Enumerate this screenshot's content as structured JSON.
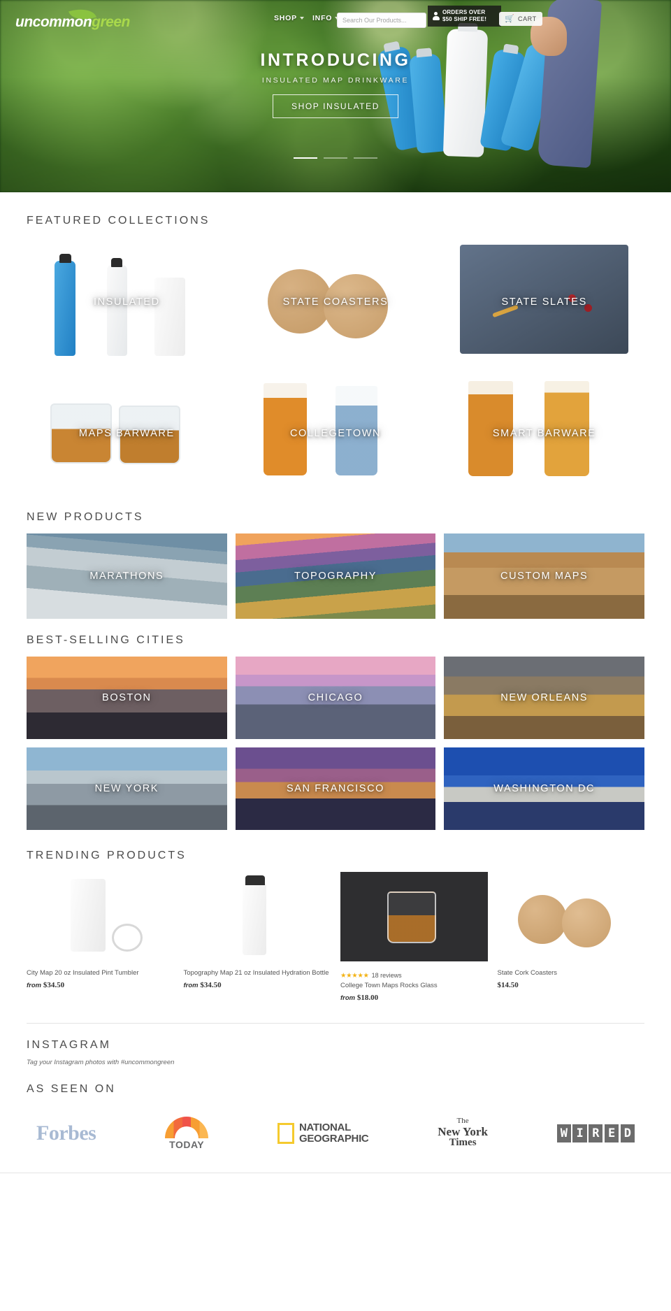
{
  "header": {
    "logo_primary": "uncommon",
    "logo_secondary": "green",
    "nav": [
      {
        "label": "SHOP",
        "icon": "chevron-down-icon"
      },
      {
        "label": "INFO",
        "icon": "chevron-down-icon"
      }
    ],
    "search_placeholder": "Search Our Products...",
    "search_value": "",
    "shipping_banner_line1": "ORDERS OVER",
    "shipping_banner_line2": "$50 SHIP FREE!",
    "cart_label": "CART",
    "cart_icon": "shopping-cart-icon",
    "account_icon": "person-icon"
  },
  "hero": {
    "title": "INTRODUCING",
    "subtitle": "INSULATED MAP DRINKWARE",
    "cta": "SHOP INSULATED",
    "slide_count": 3,
    "active_slide": 1
  },
  "featured": {
    "title": "FEATURED COLLECTIONS",
    "tiles": [
      {
        "label": "INSULATED"
      },
      {
        "label": "STATE COASTERS"
      },
      {
        "label": "STATE SLATES"
      },
      {
        "label": "MAPS BARWARE"
      },
      {
        "label": "COLLEGETOWN"
      },
      {
        "label": "SMART BARWARE"
      }
    ]
  },
  "new_products": {
    "title": "NEW PRODUCTS",
    "tiles": [
      {
        "label": "MARATHONS"
      },
      {
        "label": "TOPOGRAPHY"
      },
      {
        "label": "CUSTOM MAPS"
      }
    ]
  },
  "cities": {
    "title": "BEST-SELLING CITIES",
    "tiles": [
      {
        "label": "BOSTON"
      },
      {
        "label": "CHICAGO"
      },
      {
        "label": "NEW ORLEANS"
      },
      {
        "label": "NEW YORK"
      },
      {
        "label": "SAN FRANCISCO"
      },
      {
        "label": "WASHINGTON DC"
      }
    ]
  },
  "trending": {
    "title": "TRENDING PRODUCTS",
    "products": [
      {
        "name": "City Map 20 oz Insulated Pint Tumbler",
        "price_prefix": "from",
        "price": "$34.50",
        "has_rating": false,
        "stars": "",
        "reviews": ""
      },
      {
        "name": "Topography Map 21 oz Insulated Hydration Bottle",
        "price_prefix": "from",
        "price": "$34.50",
        "has_rating": false,
        "stars": "",
        "reviews": ""
      },
      {
        "name": "College Town Maps Rocks Glass",
        "price_prefix": "from",
        "price": "$18.00",
        "has_rating": true,
        "stars": "★★★★★",
        "reviews": "18 reviews"
      },
      {
        "name": "State Cork Coasters",
        "price_prefix": "",
        "price": "$14.50",
        "has_rating": false,
        "stars": "",
        "reviews": ""
      }
    ]
  },
  "instagram": {
    "title": "INSTAGRAM",
    "note": "Tag your Instagram photos with #uncommongreen"
  },
  "as_seen_on": {
    "title": "AS SEEN ON",
    "brands": [
      {
        "name": "Forbes"
      },
      {
        "name": "TODAY"
      },
      {
        "name": "NATIONAL",
        "name2": "GEOGRAPHIC"
      },
      {
        "name": "The",
        "name2": "New York",
        "name3": "Times"
      },
      {
        "name": "WIRED"
      }
    ]
  },
  "colors": {
    "logo_green": "#a9d94b",
    "star_gold": "#f3b316",
    "text_dark": "#4b4b4b"
  }
}
